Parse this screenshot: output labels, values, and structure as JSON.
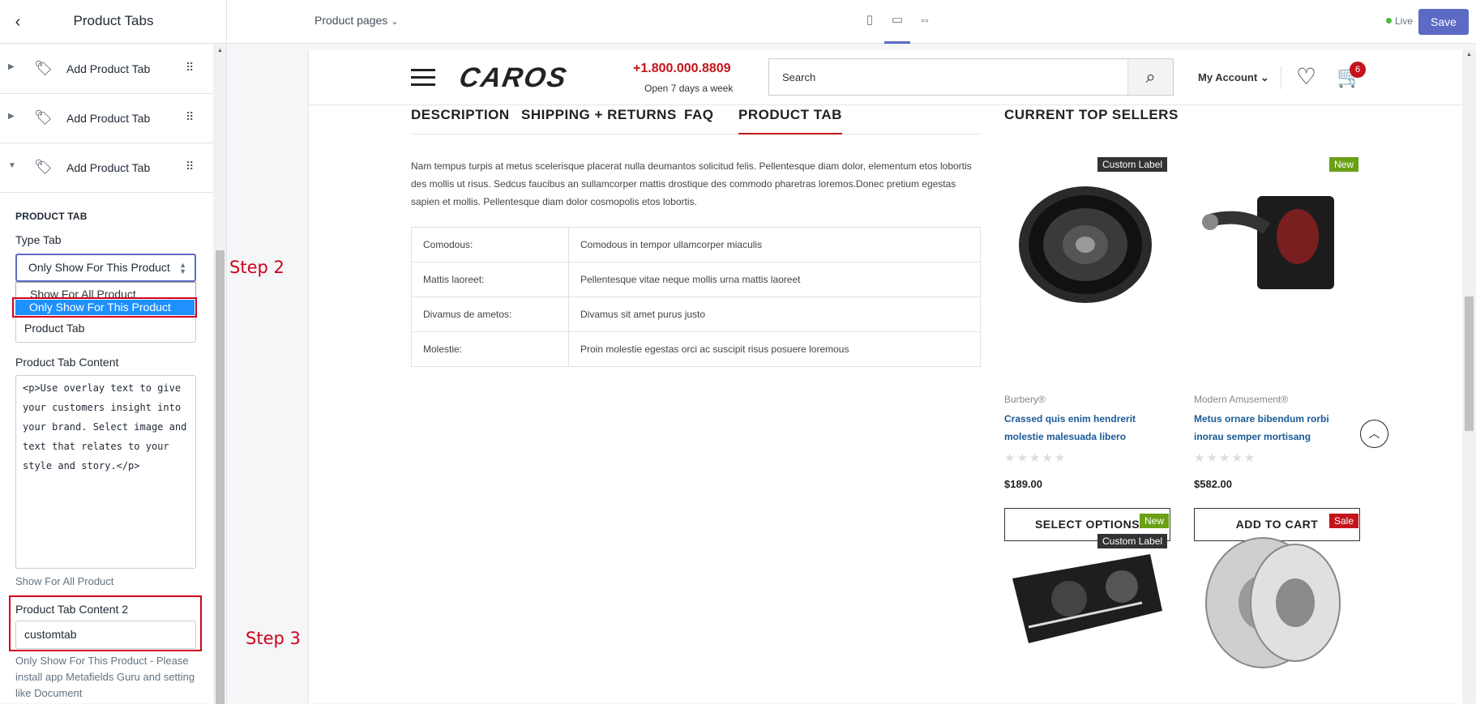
{
  "topbar": {
    "title": "Product Tabs",
    "page_select": "Product pages",
    "live_label": "Live",
    "save_label": "Save"
  },
  "sidebar": {
    "blocks": [
      {
        "label": "Add Product Tab"
      },
      {
        "label": "Add Product Tab"
      },
      {
        "label": "Add Product Tab"
      }
    ],
    "section_heading": "PRODUCT TAB",
    "type_tab_label": "Type Tab",
    "type_tab_value": "Only Show For This Product",
    "type_tab_options": [
      "Show For All Product",
      "Only Show For This Product"
    ],
    "title_value": "Product Tab",
    "content_label": "Product Tab Content",
    "content_value": "<p>Use overlay text to give\nyour customers insight into\nyour brand. Select image and\ntext that relates to your\nstyle and story.</p>",
    "content_help": "Show For All Product",
    "content2_label": "Product Tab Content 2",
    "content2_value": "customtab",
    "content2_help": "Only Show For This Product - Please install app Metafields Guru and setting like Document"
  },
  "annotations": {
    "step2": "Step 2",
    "step3": "Step 3"
  },
  "store": {
    "logo": "CAROS",
    "phone": "+1.800.000.8809",
    "hours": "Open 7 days a week",
    "search_placeholder": "Search",
    "account": "My Account",
    "cart_count": "6",
    "tabs": [
      "DESCRIPTION",
      "SHIPPING + RETURNS",
      "FAQ",
      "PRODUCT TAB"
    ],
    "description": "Nam tempus turpis at metus scelerisque placerat nulla deumantos solicitud felis. Pellentesque diam dolor, elementum etos lobortis des mollis ut risus. Sedcus faucibus an sullamcorper mattis drostique des commodo pharetras loremos.Donec pretium egestas sapien et mollis. Pellentesque diam dolor cosmopolis etos lobortis.",
    "spec": [
      {
        "k": "Comodous:",
        "v": "Comodous in tempor ullamcorper miaculis"
      },
      {
        "k": "Mattis laoreet:",
        "v": "Pellentesque vitae neque mollis urna mattis laoreet"
      },
      {
        "k": "Divamus de ametos:",
        "v": "Divamus sit amet purus justo"
      },
      {
        "k": "Molestie:",
        "v": "Proin molestie egestas orci ac suscipit risus posuere loremous"
      }
    ],
    "sellers_title": "CURRENT TOP SELLERS",
    "products": [
      {
        "badge": "Custom Label",
        "vendor": "Burbery®",
        "name": "Crassed quis enim hendrerit molestie malesuada libero",
        "price": "$189.00",
        "button": "SELECT OPTIONS",
        "image": "speaker"
      },
      {
        "badge": "New",
        "vendor": "Modern Amusement®",
        "name": "Metus ornare bibendum rorbi inorau semper mortisang",
        "price": "$582.00",
        "button": "ADD TO CART",
        "image": "air-intake"
      },
      {
        "badge": "New",
        "badge2": "Custom Label",
        "image": "headlight"
      },
      {
        "badge": "Sale",
        "image": "brake-rotor"
      }
    ]
  }
}
